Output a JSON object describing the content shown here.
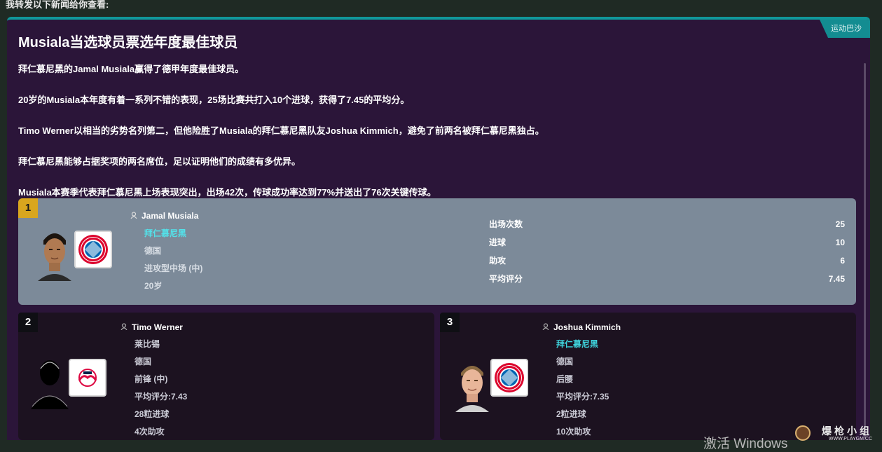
{
  "forward_note": "我转发以下新闻给你查看:",
  "article": {
    "source": "运动巴沙",
    "headline": "Musiala当选球员票选年度最佳球员",
    "paragraphs": [
      "拜仁慕尼黑的Jamal Musiala赢得了德甲年度最佳球员。",
      "20岁的Musiala本年度有着一系列不错的表现，25场比赛共打入10个进球，获得了7.45的平均分。",
      "Timo Werner以相当的劣势名列第二，但他险胜了Musiala的拜仁慕尼黑队友Joshua Kimmich，避免了前两名被拜仁慕尼黑独占。",
      "拜仁慕尼黑能够占据奖项的两名席位，足以证明他们的成绩有多优异。",
      "Musiala本赛季代表拜仁慕尼黑上场表现突出，出场42次，传球成功率达到77%并送出了76次关键传球。"
    ]
  },
  "first": {
    "rank": "1",
    "name": "Jamal Musiala",
    "club": "拜仁慕尼黑",
    "nation": "德国",
    "position": "进攻型中场 (中)",
    "age": "20岁",
    "stats": [
      {
        "label": "出场次数",
        "value": "25"
      },
      {
        "label": "进球",
        "value": "10"
      },
      {
        "label": "助攻",
        "value": "6"
      },
      {
        "label": "平均评分",
        "value": "7.45"
      }
    ]
  },
  "second": {
    "rank": "2",
    "name": "Timo Werner",
    "club": "莱比锡",
    "nation": "德国",
    "position": "前锋 (中)",
    "rating": "平均评分:7.43",
    "goals": "28粒进球",
    "assists": "4次助攻"
  },
  "third": {
    "rank": "3",
    "name": "Joshua Kimmich",
    "club": "拜仁慕尼黑",
    "nation": "德国",
    "position": "后腰",
    "rating": "平均评分:7.35",
    "goals": "2粒进球",
    "assists": "10次助攻"
  },
  "overlay": {
    "windows_activate": "激活 Windows",
    "site_name": "爆枪小组",
    "site_url": "WWW.PLAYGM.CC"
  },
  "colors": {
    "panel_bg": "#2b1539",
    "accent_teal": "#10979a",
    "gold_rank": "#d9a61e",
    "club_link": "#3fd3dc"
  },
  "icons": {
    "player": "person-icon",
    "bayern": "bayern-crest-icon",
    "leipzig": "leipzig-crest-icon"
  }
}
